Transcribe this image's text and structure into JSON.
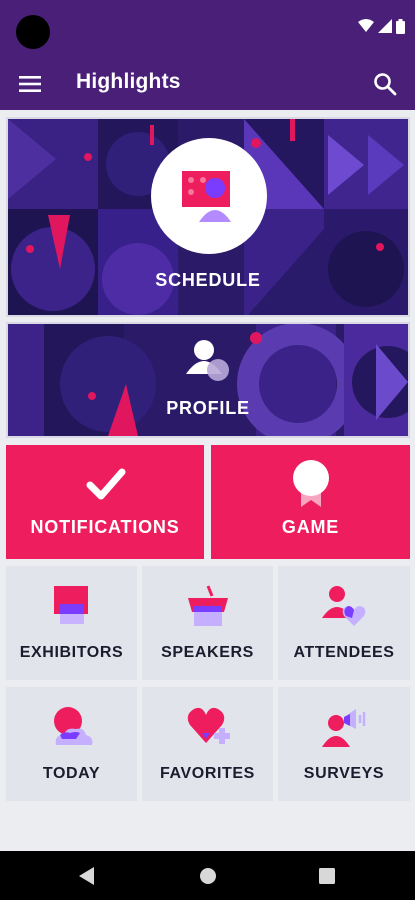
{
  "app_bar": {
    "title": "Highlights"
  },
  "icons": {
    "menu": "hamburger-menu-icon",
    "search": "search-icon",
    "wifi": "wifi-icon",
    "signal": "signal-icon",
    "battery": "battery-icon"
  },
  "tiles": {
    "schedule": "SCHEDULE",
    "profile": "PROFILE",
    "notifications": "NOTIFICATIONS",
    "game": "GAME"
  },
  "grid": [
    {
      "label": "EXHIBITORS",
      "icon": "exhibitors-icon"
    },
    {
      "label": "SPEAKERS",
      "icon": "speakers-icon"
    },
    {
      "label": "ATTENDEES",
      "icon": "attendees-icon"
    },
    {
      "label": "TODAY",
      "icon": "today-icon"
    },
    {
      "label": "FAVORITES",
      "icon": "favorites-icon"
    },
    {
      "label": "SURVEYS",
      "icon": "surveys-icon"
    }
  ],
  "colors": {
    "app_bar": "#4a1f78",
    "accent_pink": "#ee1d5e",
    "accent_purple": "#7a3cff",
    "tile_bg": "#e2e4ec"
  }
}
